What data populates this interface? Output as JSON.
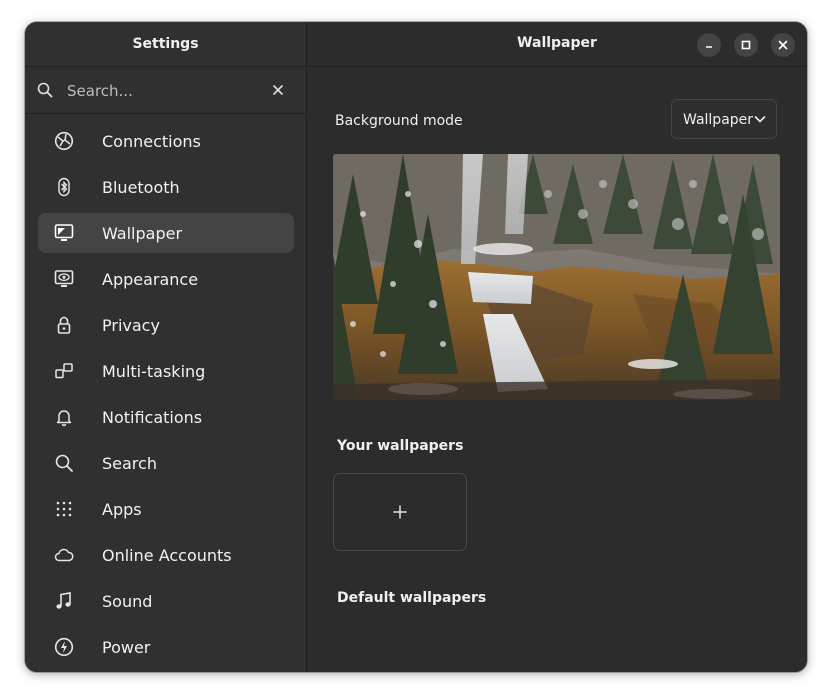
{
  "sidebar": {
    "title": "Settings",
    "search_placeholder": "Search...",
    "items": [
      {
        "label": "Connections",
        "icon": "globe-icon"
      },
      {
        "label": "Bluetooth",
        "icon": "bluetooth-icon"
      },
      {
        "label": "Wallpaper",
        "icon": "wallpaper-icon",
        "active": true
      },
      {
        "label": "Appearance",
        "icon": "appearance-icon"
      },
      {
        "label": "Privacy",
        "icon": "lock-icon"
      },
      {
        "label": "Multi-tasking",
        "icon": "multitasking-icon"
      },
      {
        "label": "Notifications",
        "icon": "bell-icon"
      },
      {
        "label": "Search",
        "icon": "search-icon"
      },
      {
        "label": "Apps",
        "icon": "apps-grid-icon"
      },
      {
        "label": "Online Accounts",
        "icon": "cloud-icon"
      },
      {
        "label": "Sound",
        "icon": "music-note-icon"
      },
      {
        "label": "Power",
        "icon": "power-icon"
      }
    ]
  },
  "main": {
    "title": "Wallpaper",
    "background_mode_label": "Background mode",
    "background_mode_value": "Wallpaper",
    "your_wallpapers_title": "Your wallpapers",
    "default_wallpapers_title": "Default wallpapers",
    "add_wallpaper_symbol": "+"
  },
  "window_controls": [
    "minimize-icon",
    "maximize-icon",
    "close-icon"
  ],
  "colors": {
    "window_bg": "#2c2c2c",
    "sidebar_bg": "#303030",
    "active_item_bg": "#444444",
    "text": "#f2f2f2"
  }
}
